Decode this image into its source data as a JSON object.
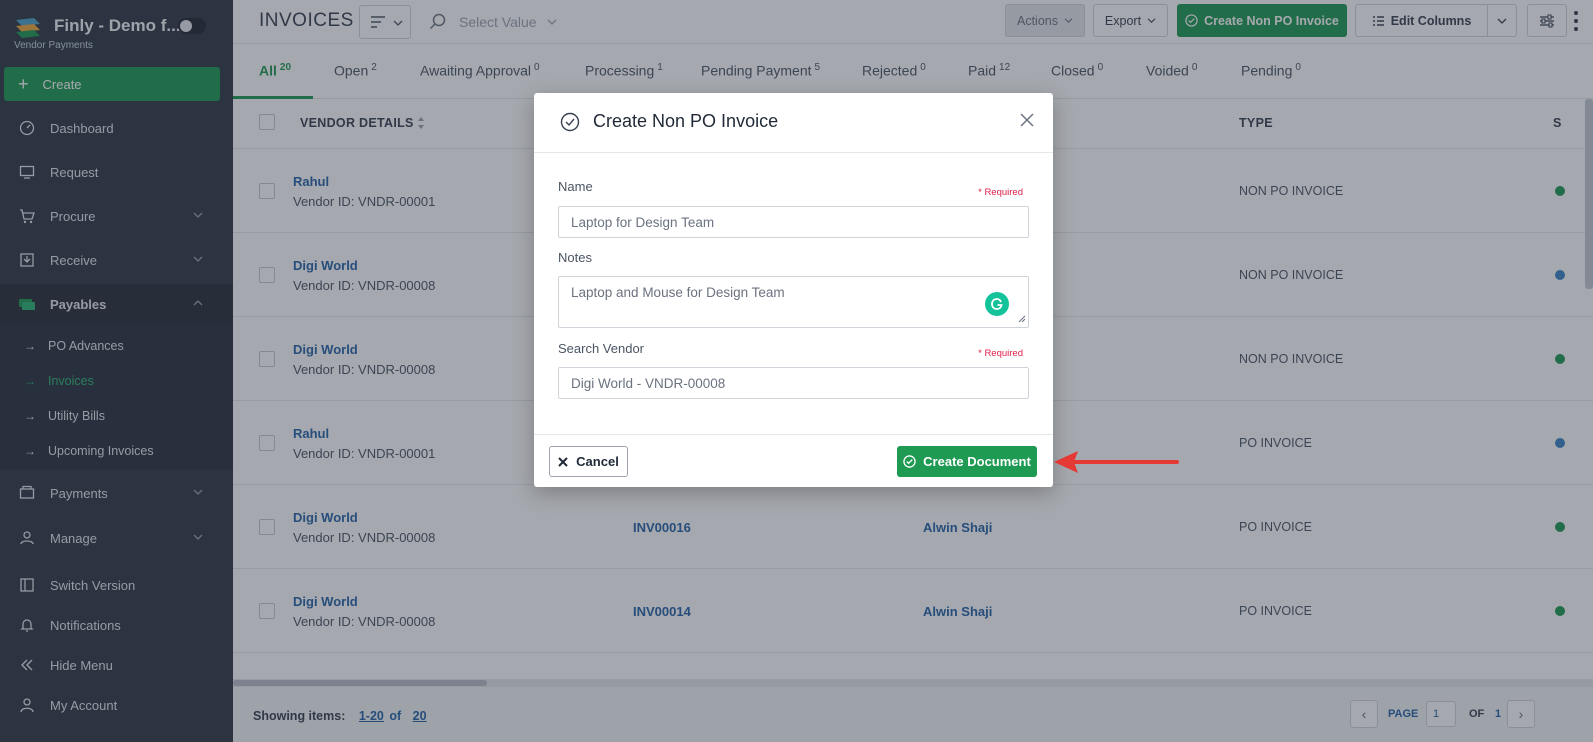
{
  "brand": {
    "title": "Finly - Demo f...",
    "subtitle": "Vendor Payments"
  },
  "sidebar": {
    "create_label": "Create",
    "items": [
      {
        "label": "Dashboard",
        "icon": "dashboard-icon"
      },
      {
        "label": "Request",
        "icon": "request-icon"
      },
      {
        "label": "Procure",
        "icon": "cart-icon"
      },
      {
        "label": "Receive",
        "icon": "receive-icon"
      },
      {
        "label": "Payables",
        "icon": "money-icon"
      },
      {
        "label": "Payments",
        "icon": "payments-icon"
      },
      {
        "label": "Manage",
        "icon": "users-icon"
      },
      {
        "label": "Switch Version",
        "icon": "switch-icon"
      },
      {
        "label": "Notifications",
        "icon": "bell-icon"
      },
      {
        "label": "Hide Menu",
        "icon": "double-chevron-left-icon"
      },
      {
        "label": "My Account",
        "icon": "user-icon"
      }
    ],
    "payables_sub": [
      "PO Advances",
      "Invoices",
      "Utility Bills",
      "Upcoming Invoices"
    ],
    "active_sub": "Invoices"
  },
  "topbar": {
    "title": "INVOICES",
    "search_placeholder": "Select Value",
    "actions_label": "Actions",
    "export_label": "Export",
    "create_label": "Create Non PO Invoice",
    "edit_columns_label": "Edit Columns"
  },
  "tabs": [
    {
      "label": "All",
      "count": "20"
    },
    {
      "label": "Open",
      "count": "2"
    },
    {
      "label": "Awaiting Approval",
      "count": "0"
    },
    {
      "label": "Processing",
      "count": "1"
    },
    {
      "label": "Pending Payment",
      "count": "5"
    },
    {
      "label": "Rejected",
      "count": "0"
    },
    {
      "label": "Paid",
      "count": "12"
    },
    {
      "label": "Closed",
      "count": "0"
    },
    {
      "label": "Voided",
      "count": "0"
    },
    {
      "label": "Pending",
      "count": "0"
    }
  ],
  "grid": {
    "headers": {
      "vendor": "VENDOR DETAILS",
      "type": "TYPE",
      "status_partial": "S"
    },
    "rows": [
      {
        "vendor": "Rahul",
        "vendor_id": "Vendor ID: VNDR-00001",
        "invoice": "",
        "created_by": "",
        "type": "NON PO INVOICE",
        "dot": "#1e9a52"
      },
      {
        "vendor": "Digi World",
        "vendor_id": "Vendor ID: VNDR-00008",
        "invoice": "",
        "created_by": "",
        "type": "NON PO INVOICE",
        "dot": "#3b82c4"
      },
      {
        "vendor": "Digi World",
        "vendor_id": "Vendor ID: VNDR-00008",
        "invoice": "",
        "created_by": "",
        "type": "NON PO INVOICE",
        "dot": "#1e9a52"
      },
      {
        "vendor": "Rahul",
        "vendor_id": "Vendor ID: VNDR-00001",
        "invoice": "",
        "created_by": "",
        "type": "PO INVOICE",
        "dot": "#3b82c4"
      },
      {
        "vendor": "Digi World",
        "vendor_id": "Vendor ID: VNDR-00008",
        "invoice": "INV00016",
        "created_by": "Alwin Shaji",
        "type": "PO INVOICE",
        "dot": "#1e9a52"
      },
      {
        "vendor": "Digi World",
        "vendor_id": "Vendor ID: VNDR-00008",
        "invoice": "INV00014",
        "created_by": "Alwin Shaji",
        "type": "PO INVOICE",
        "dot": "#1e9a52"
      }
    ]
  },
  "footer": {
    "showing_label": "Showing items:",
    "range": "1-20",
    "of_word": "of",
    "total": "20",
    "page_label": "PAGE",
    "page_value": "1",
    "of_label": "OF",
    "page_total": "1"
  },
  "modal": {
    "title": "Create Non PO Invoice",
    "name_label": "Name",
    "name_value": "Laptop for Design Team",
    "required": "* Required",
    "notes_label": "Notes",
    "notes_value": "Laptop and Mouse for Design Team",
    "vendor_label": "Search Vendor",
    "vendor_value": "Digi World - VNDR-00008",
    "cancel_label": "Cancel",
    "create_label": "Create Document"
  },
  "colors": {
    "brand_green": "#1e9a52",
    "link_blue": "#2563a8",
    "sidebar_bg": "#2f3744",
    "arrow_red": "#e53935"
  }
}
